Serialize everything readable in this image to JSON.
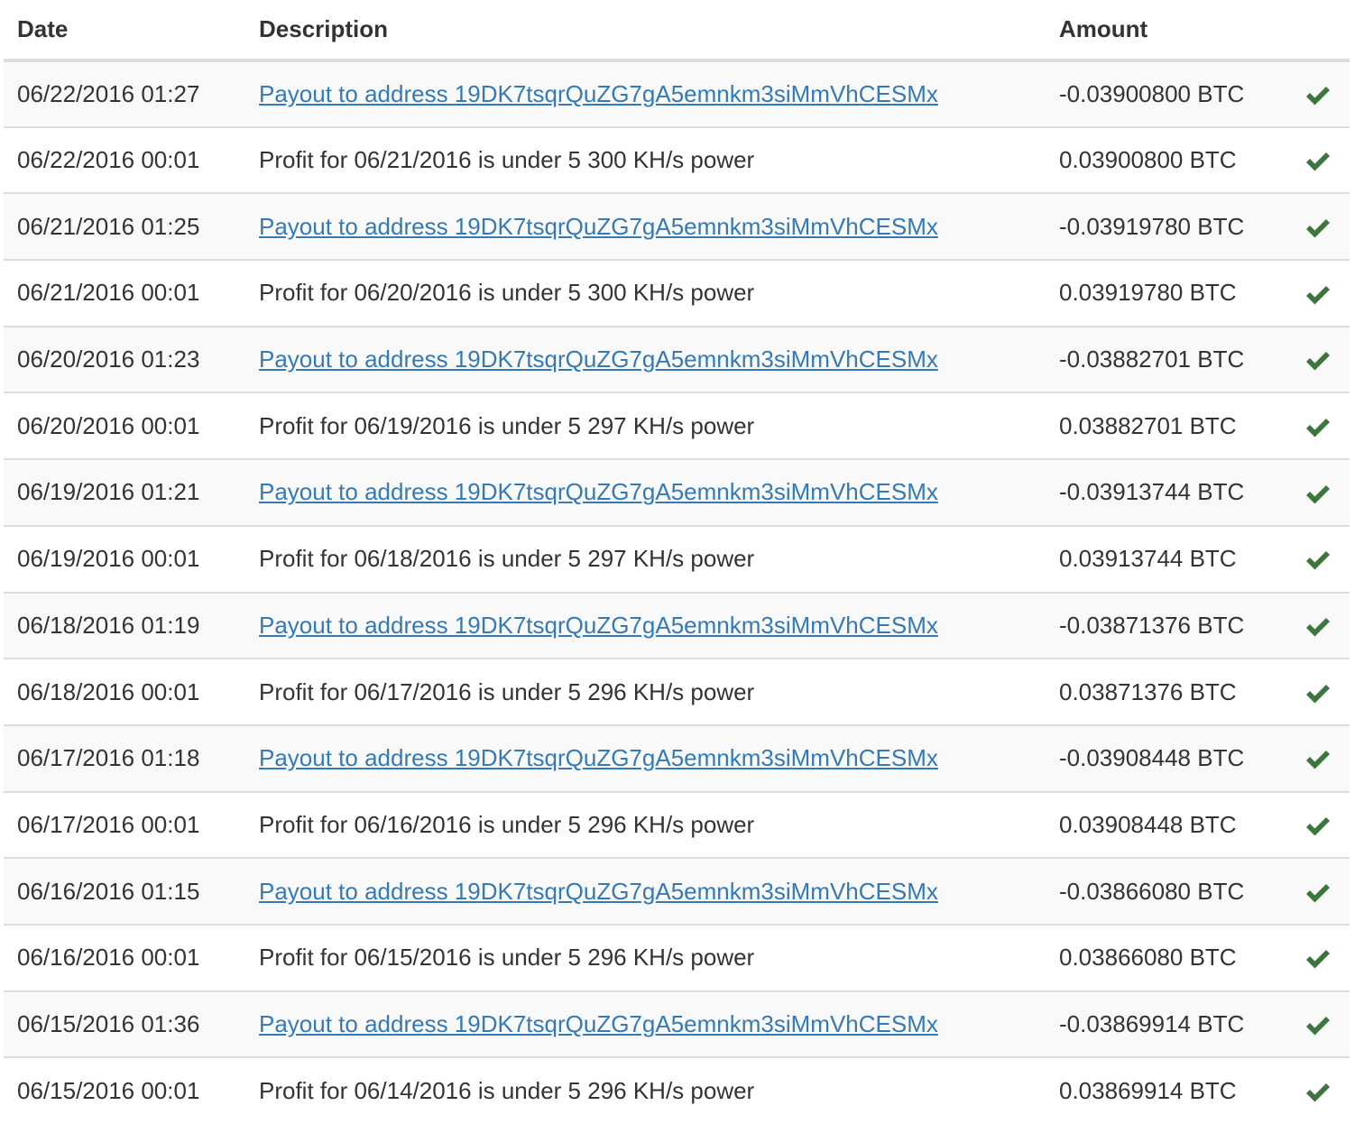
{
  "table": {
    "headers": {
      "date": "Date",
      "description": "Description",
      "amount": "Amount",
      "status": ""
    },
    "colors": {
      "link": "#337ab7",
      "check": "#3c763d",
      "row_stripe": "#f9f9f9",
      "border": "#dddddd"
    },
    "status_icon": "check-icon",
    "rows": [
      {
        "date": "06/22/2016 01:27",
        "description": "Payout to address 19DK7tsqrQuZG7gA5emnkm3siMmVhCESMx",
        "is_link": true,
        "amount": "-0.03900800 BTC",
        "status": "confirmed"
      },
      {
        "date": "06/22/2016 00:01",
        "description": "Profit for 06/21/2016 is under 5 300 KH/s power",
        "is_link": false,
        "amount": "0.03900800 BTC",
        "status": "confirmed"
      },
      {
        "date": "06/21/2016 01:25",
        "description": "Payout to address 19DK7tsqrQuZG7gA5emnkm3siMmVhCESMx",
        "is_link": true,
        "amount": "-0.03919780 BTC",
        "status": "confirmed"
      },
      {
        "date": "06/21/2016 00:01",
        "description": "Profit for 06/20/2016 is under 5 300 KH/s power",
        "is_link": false,
        "amount": "0.03919780 BTC",
        "status": "confirmed"
      },
      {
        "date": "06/20/2016 01:23",
        "description": "Payout to address 19DK7tsqrQuZG7gA5emnkm3siMmVhCESMx",
        "is_link": true,
        "amount": "-0.03882701 BTC",
        "status": "confirmed"
      },
      {
        "date": "06/20/2016 00:01",
        "description": "Profit for 06/19/2016 is under 5 297 KH/s power",
        "is_link": false,
        "amount": "0.03882701 BTC",
        "status": "confirmed"
      },
      {
        "date": "06/19/2016 01:21",
        "description": "Payout to address 19DK7tsqrQuZG7gA5emnkm3siMmVhCESMx",
        "is_link": true,
        "amount": "-0.03913744 BTC",
        "status": "confirmed"
      },
      {
        "date": "06/19/2016 00:01",
        "description": "Profit for 06/18/2016 is under 5 297 KH/s power",
        "is_link": false,
        "amount": "0.03913744 BTC",
        "status": "confirmed"
      },
      {
        "date": "06/18/2016 01:19",
        "description": "Payout to address 19DK7tsqrQuZG7gA5emnkm3siMmVhCESMx",
        "is_link": true,
        "amount": "-0.03871376 BTC",
        "status": "confirmed"
      },
      {
        "date": "06/18/2016 00:01",
        "description": "Profit for 06/17/2016 is under 5 296 KH/s power",
        "is_link": false,
        "amount": "0.03871376 BTC",
        "status": "confirmed"
      },
      {
        "date": "06/17/2016 01:18",
        "description": "Payout to address 19DK7tsqrQuZG7gA5emnkm3siMmVhCESMx",
        "is_link": true,
        "amount": "-0.03908448 BTC",
        "status": "confirmed"
      },
      {
        "date": "06/17/2016 00:01",
        "description": "Profit for 06/16/2016 is under 5 296 KH/s power",
        "is_link": false,
        "amount": "0.03908448 BTC",
        "status": "confirmed"
      },
      {
        "date": "06/16/2016 01:15",
        "description": "Payout to address 19DK7tsqrQuZG7gA5emnkm3siMmVhCESMx",
        "is_link": true,
        "amount": "-0.03866080 BTC",
        "status": "confirmed"
      },
      {
        "date": "06/16/2016 00:01",
        "description": "Profit for 06/15/2016 is under 5 296 KH/s power",
        "is_link": false,
        "amount": "0.03866080 BTC",
        "status": "confirmed"
      },
      {
        "date": "06/15/2016 01:36",
        "description": "Payout to address 19DK7tsqrQuZG7gA5emnkm3siMmVhCESMx",
        "is_link": true,
        "amount": "-0.03869914 BTC",
        "status": "confirmed"
      },
      {
        "date": "06/15/2016 00:01",
        "description": "Profit for 06/14/2016 is under 5 296 KH/s power",
        "is_link": false,
        "amount": "0.03869914 BTC",
        "status": "confirmed"
      }
    ]
  }
}
